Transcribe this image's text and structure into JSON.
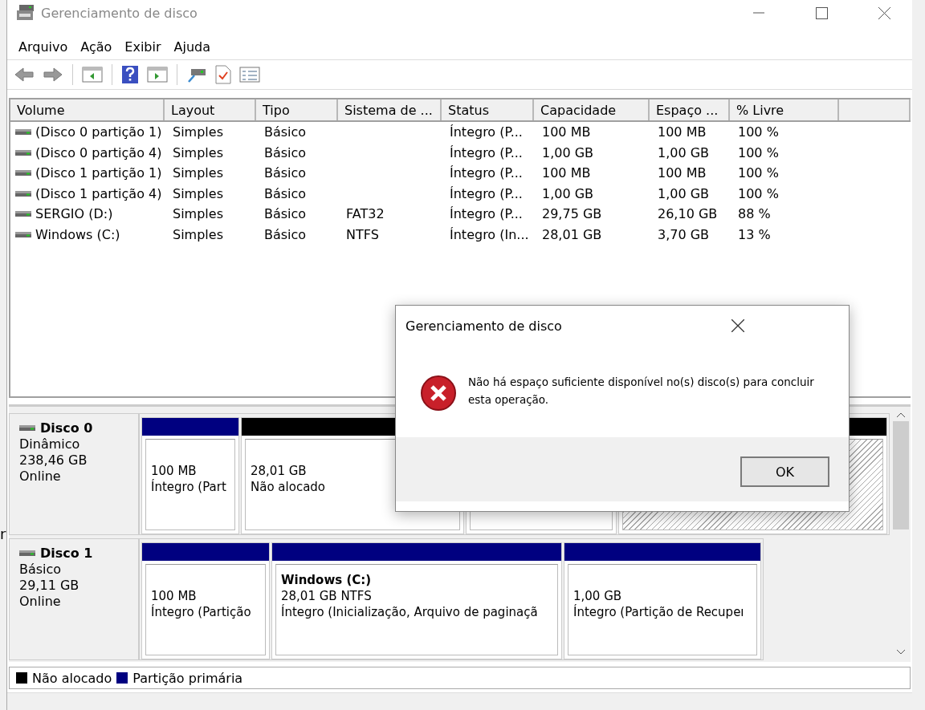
{
  "window": {
    "title": "Gerenciamento de disco"
  },
  "background_fragment": "r",
  "menu": [
    "Arquivo",
    "Ação",
    "Exibir",
    "Ajuda"
  ],
  "volume_table": {
    "columns": [
      "Volume",
      "Layout",
      "Tipo",
      "Sistema de ...",
      "Status",
      "Capacidade",
      "Espaço ...",
      "% Livre"
    ],
    "rows": [
      [
        "(Disco 0 partição 1)",
        "Simples",
        "Básico",
        "",
        "Íntegro (P...",
        "100 MB",
        "100 MB",
        "100 %"
      ],
      [
        "(Disco 0 partição 4)",
        "Simples",
        "Básico",
        "",
        "Íntegro (P...",
        "1,00 GB",
        "1,00 GB",
        "100 %"
      ],
      [
        "(Disco 1 partição 1)",
        "Simples",
        "Básico",
        "",
        "Íntegro (P...",
        "100 MB",
        "100 MB",
        "100 %"
      ],
      [
        "(Disco 1 partição 4)",
        "Simples",
        "Básico",
        "",
        "Íntegro (P...",
        "1,00 GB",
        "1,00 GB",
        "100 %"
      ],
      [
        "SERGIO (D:)",
        "Simples",
        "Básico",
        "FAT32",
        "Íntegro (P...",
        "29,75 GB",
        "26,10 GB",
        "88 %"
      ],
      [
        "Windows (C:)",
        "Simples",
        "Básico",
        "NTFS",
        "Íntegro (In...",
        "28,01 GB",
        "3,70 GB",
        "13 %"
      ]
    ]
  },
  "disks": [
    {
      "name": "Disco 0",
      "type": "Dinâmico",
      "size": "238,46 GB",
      "state": "Online",
      "partitions": [
        {
          "kind": "primary",
          "lines": [
            "100 MB",
            "Íntegro (Part"
          ]
        },
        {
          "kind": "unallocated",
          "lines": [
            "28,01 GB",
            "Não alocado"
          ]
        },
        {
          "kind": "covered"
        },
        {
          "kind": "unallocated",
          "hatched": true
        }
      ]
    },
    {
      "name": "Disco 1",
      "type": "Básico",
      "size": "29,11 GB",
      "state": "Online",
      "partitions": [
        {
          "kind": "primary",
          "lines": [
            "100 MB",
            "Íntegro (Partição"
          ]
        },
        {
          "kind": "primary",
          "title": "Windows  (C:)",
          "lines": [
            "28,01 GB NTFS",
            "Íntegro (Inicialização, Arquivo de paginaçã"
          ]
        },
        {
          "kind": "primary",
          "lines": [
            "1,00 GB",
            "Íntegro (Partição de Recupeı"
          ]
        }
      ]
    }
  ],
  "legend": [
    {
      "kind": "unallocated",
      "label": "Não alocado"
    },
    {
      "kind": "primary",
      "label": "Partição primária"
    }
  ],
  "dialog": {
    "title": "Gerenciamento de disco",
    "message": "Não há espaço suficiente disponível no(s) disco(s) para concluir esta operação.",
    "buttons": [
      "OK"
    ]
  }
}
